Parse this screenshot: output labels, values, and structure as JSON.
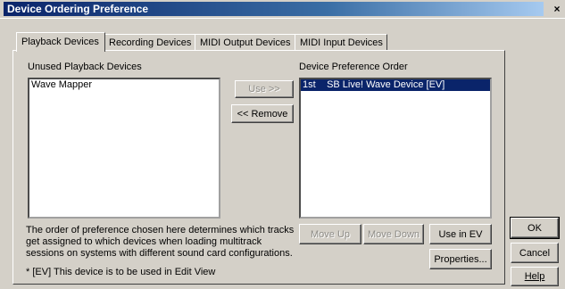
{
  "window": {
    "title": "Device Ordering Preference",
    "close_glyph": "×"
  },
  "tabs": [
    {
      "label": "Playback Devices",
      "active": true
    },
    {
      "label": "Recording Devices",
      "active": false
    },
    {
      "label": "MIDI Output Devices",
      "active": false
    },
    {
      "label": "MIDI Input Devices",
      "active": false
    }
  ],
  "unused": {
    "label": "Unused Playback Devices",
    "items": [
      "Wave Mapper"
    ]
  },
  "preference": {
    "label": "Device Preference Order",
    "items": [
      {
        "rank": "1st",
        "name": "SB Live! Wave Device [EV]",
        "selected": true
      }
    ]
  },
  "buttons": {
    "use": "Use >>",
    "remove": "<< Remove",
    "move_up": "Move Up",
    "move_down": "Move Down",
    "use_in_ev": "Use in EV",
    "properties": "Properties...",
    "ok": "OK",
    "cancel": "Cancel",
    "help": "Help"
  },
  "notes": {
    "order_line1": "The order of preference chosen here determines which tracks",
    "order_line2": "get assigned to which devices when loading multitrack",
    "order_line3": "sessions on systems with different sound card configurations.",
    "ev": "* [EV] This device is to be used in Edit View"
  }
}
